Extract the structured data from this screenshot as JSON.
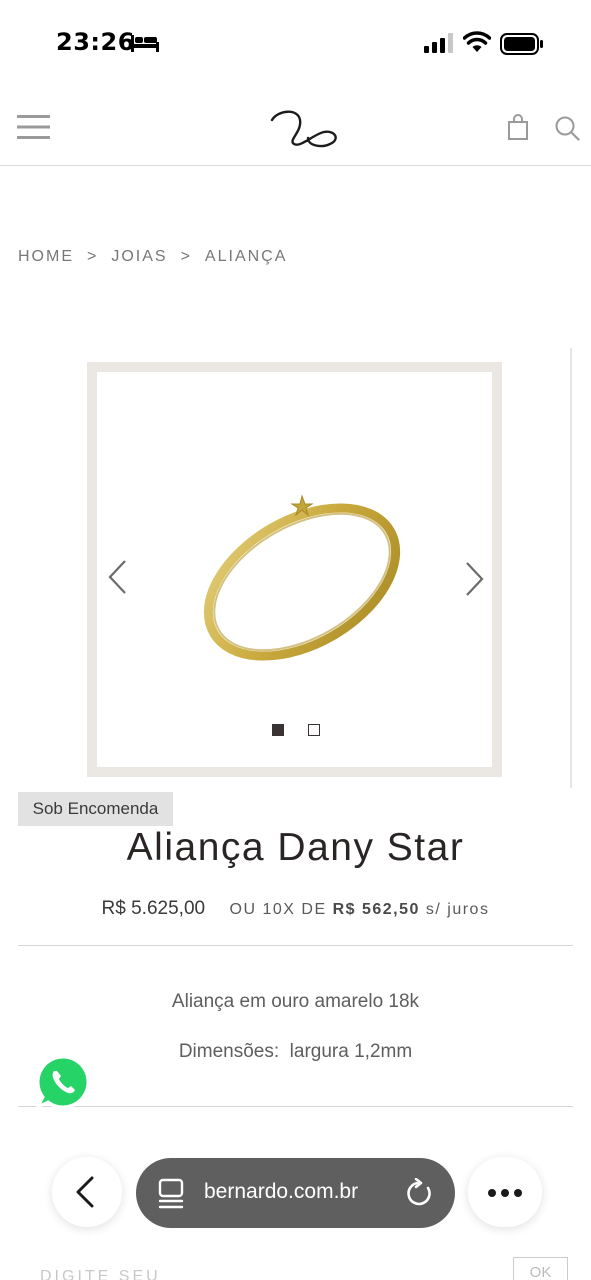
{
  "status_bar": {
    "time": "23:26",
    "focus_icon": "bed-icon",
    "signal_icon": "cellular-signal-icon",
    "wifi_icon": "wifi-icon",
    "battery_icon": "battery-icon"
  },
  "header": {
    "menu_icon": "hamburger-menu-icon",
    "logo_icon": "brand-logo-icon",
    "bag_icon": "shopping-bag-icon",
    "search_icon": "search-icon"
  },
  "breadcrumb": {
    "items": [
      "HOME",
      "JOIAS",
      "ALIANÇA"
    ],
    "separator": ">"
  },
  "carousel": {
    "image_alt_icon": "gold-ring-image",
    "prev_icon": "chevron-left-icon",
    "next_icon": "chevron-right-icon",
    "slide_count": 2,
    "active_slide": 1
  },
  "product": {
    "badge": "Sob Encomenda",
    "title": "Aliança Dany Star",
    "price": "R$ 5.625,00",
    "installment_prefix": "OU 10X DE",
    "installment_value": "R$ 562,50",
    "installment_suffix": "s/ juros",
    "description_line1": "Aliança em ouro amarelo 18k",
    "description_line2": "Dimensões:  largura 1,2mm"
  },
  "footer_peek": {
    "text": "DIGITE SEU",
    "ok_label": "OK"
  },
  "browser_bar": {
    "back_icon": "chevron-left-icon",
    "tabs_icon": "tabs-icon",
    "url": "bernardo.com.br",
    "reload_icon": "reload-icon",
    "more_icon": "more-dots-icon"
  },
  "colors": {
    "frame": "#ebe8e3",
    "gold": "#c9a93c",
    "whatsapp_green": "#25d366",
    "url_pill": "#5f5f5f"
  }
}
